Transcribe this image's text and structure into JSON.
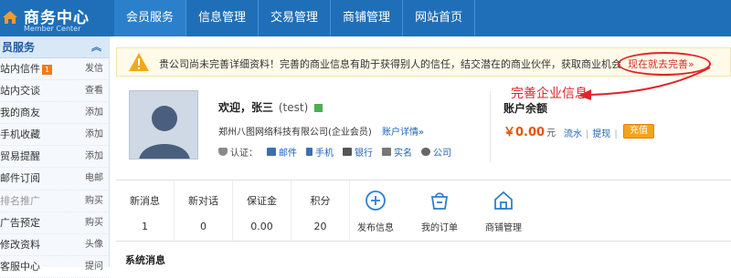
{
  "brand": {
    "title": "商务中心",
    "subtitle": "Member Center"
  },
  "nav": {
    "tabs": [
      "会员服务",
      "信息管理",
      "交易管理",
      "商铺管理",
      "网站首页"
    ]
  },
  "sidebar": {
    "header": "员服务",
    "items": [
      {
        "label": "站内信件",
        "badge": "1",
        "action": "发信"
      },
      {
        "label": "站内交谈",
        "action": "查看"
      },
      {
        "label": "我的商友",
        "action": "添加"
      },
      {
        "label": "手机收藏",
        "action": "添加"
      },
      {
        "label": "贸易提醒",
        "action": "添加"
      },
      {
        "label": "邮件订阅",
        "action": "电邮"
      },
      {
        "label": "排名推广",
        "action": "购买"
      },
      {
        "label": "广告预定",
        "action": "购买"
      },
      {
        "label": "修改资料",
        "action": "头像"
      },
      {
        "label": "客服中心",
        "action": "提问"
      }
    ]
  },
  "notice": {
    "message": "贵公司尚未完善详细资料！完善的商业信息有助于获得别人的信任，结交潜在的商业伙伴，获取商业机会",
    "link": "现在就去完善»"
  },
  "annotation": "完善企业信息",
  "profile": {
    "welcome": "欢迎，张三",
    "username": "(test)",
    "company": "郑州八图网络科技有限公司(企业会员)",
    "account_link": "账户详情»",
    "verify_label": "认证：",
    "verify_items": [
      "邮件",
      "手机",
      "银行",
      "实名",
      "公司"
    ]
  },
  "account": {
    "title": "账户余额",
    "amount": "￥0.00",
    "unit": "元",
    "flow": "流水",
    "withdraw": "提现",
    "recharge": "充值"
  },
  "stats": [
    {
      "label": "新消息",
      "value": "1"
    },
    {
      "label": "新对话",
      "value": "0"
    },
    {
      "label": "保证金",
      "value": "0.00"
    },
    {
      "label": "积分",
      "value": "20"
    }
  ],
  "quick_actions": [
    {
      "label": "发布信息",
      "icon": "plus-circle-icon"
    },
    {
      "label": "我的订单",
      "icon": "shopping-bag-icon"
    },
    {
      "label": "商铺管理",
      "icon": "home-icon"
    }
  ],
  "system_messages": {
    "title": "系统消息"
  },
  "colors": {
    "nav_blue": "#1f6fb8",
    "alert_red": "#e0242a",
    "money_orange": "#e65500",
    "link_blue": "#1f63b5"
  }
}
